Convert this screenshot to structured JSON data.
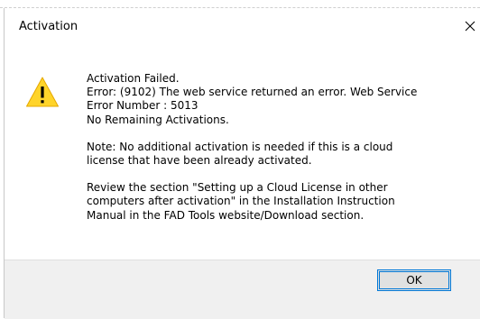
{
  "dialog": {
    "title": "Activation",
    "icon": "warning-icon",
    "close_icon": "close-icon",
    "message": {
      "line1": "Activation Failed.",
      "line2": "Error: (9102) The web service returned an error. Web Service",
      "line3": "Error Number : 5013",
      "line4": "No Remaining Activations.",
      "note_line1": "Note: No additional activation is needed if this is a cloud",
      "note_line2": "license that have been already activated.",
      "review_line1": "Review the section \"Setting up a Cloud License in other",
      "review_line2": "computers after activation\" in the Installation Instruction",
      "review_line3": "Manual in the FAD Tools website/Download section."
    },
    "ok_label": "OK"
  },
  "colors": {
    "warning_fill": "#ffd42a",
    "focus_border": "#0078d7",
    "footer_bg": "#f0f0f0"
  }
}
